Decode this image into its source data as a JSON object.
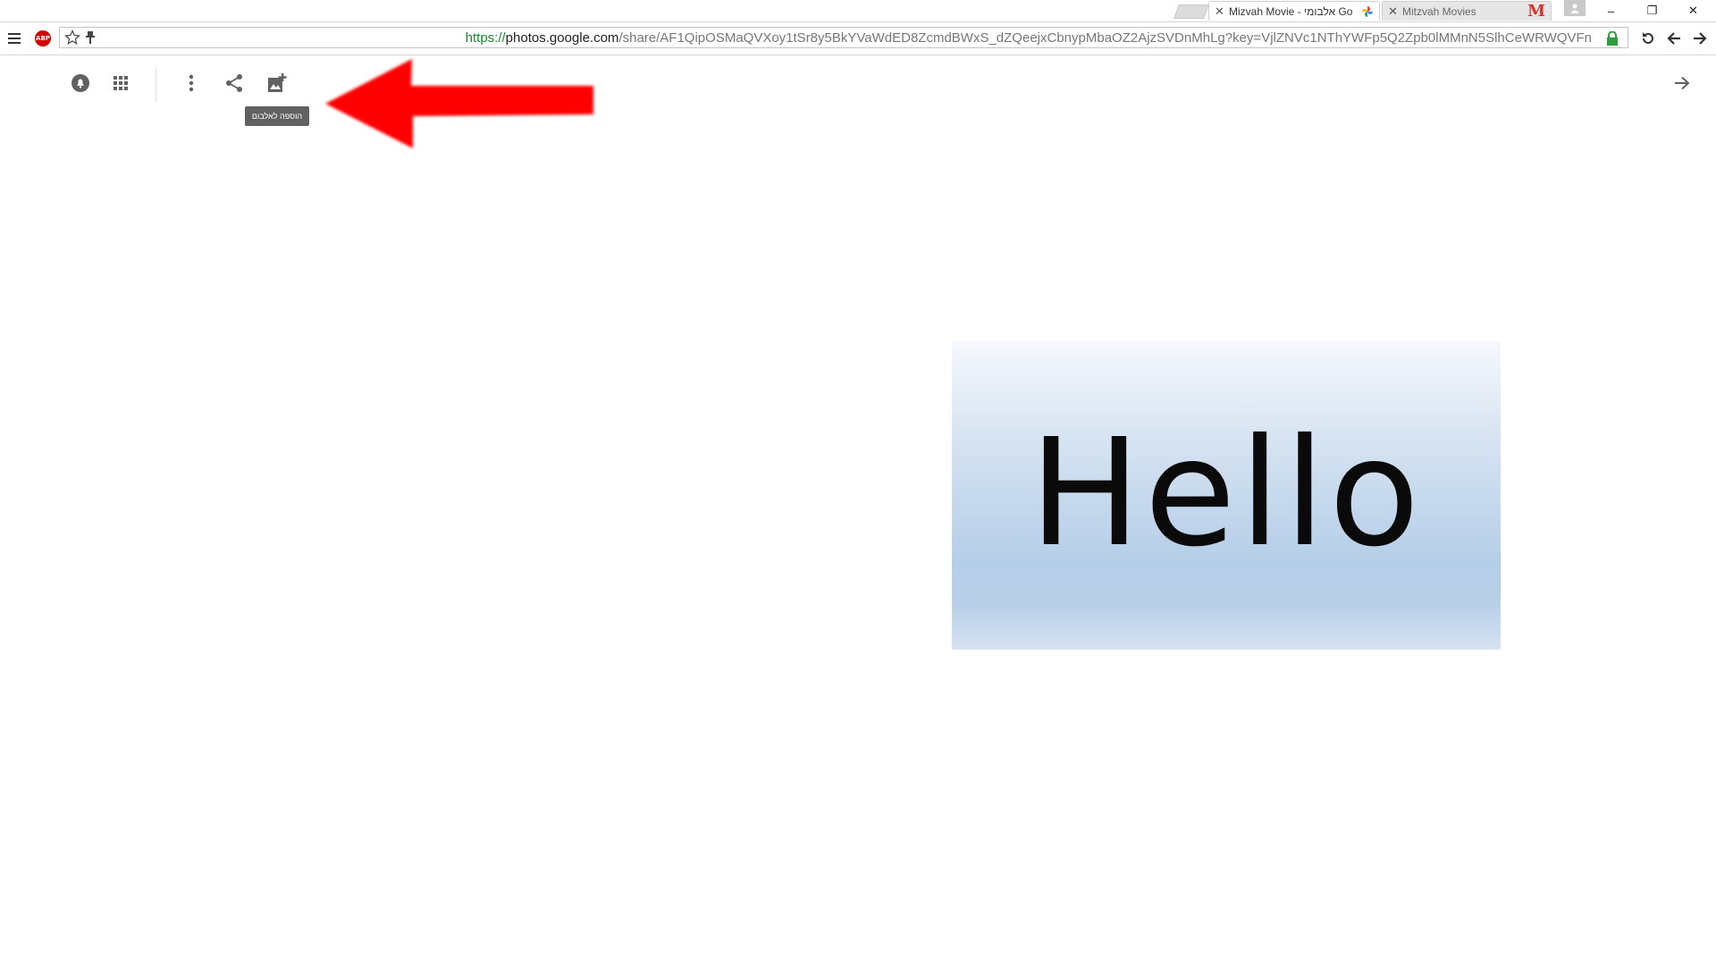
{
  "browser": {
    "tabs": [
      {
        "title": "Mizvah Movie - אלבומי Go",
        "active": true
      },
      {
        "title": "Mitzvah Movies",
        "active": false
      }
    ],
    "url": {
      "scheme": "https://",
      "host": "photos.google.com",
      "path": "/share/AF1QipOSMaQVXoy1tSr8y5BkYVaWdED8ZcmdBWxS_dZQeejxCbnypMbaOZ2AjzSVDnMhLg?key=VjlZNVc1NThYWFp5Q2Zpb0lMMnN5SlhCeWRWQVFn"
    },
    "extensions": {
      "abp_label": "ABP"
    },
    "window_controls": {
      "minimize": "–",
      "restore": "❐",
      "close": "✕"
    },
    "icons": {
      "menu": "hamburger-menu-icon",
      "star": "bookmark-star-icon",
      "pin": "pin-icon",
      "reload": "reload-icon",
      "back": "back-arrow-icon",
      "forward": "forward-arrow-icon"
    }
  },
  "photo_viewer": {
    "actions": [
      {
        "name": "info-icon"
      },
      {
        "name": "apps-grid-icon"
      },
      {
        "name": "more-vert-icon"
      },
      {
        "name": "share-icon"
      },
      {
        "name": "add-to-album-icon"
      }
    ],
    "tooltip": "הוספה לאלבום",
    "next_arrow": "next-arrow-icon",
    "photo_text": "Hello",
    "annotation_color": "#ff0000"
  }
}
